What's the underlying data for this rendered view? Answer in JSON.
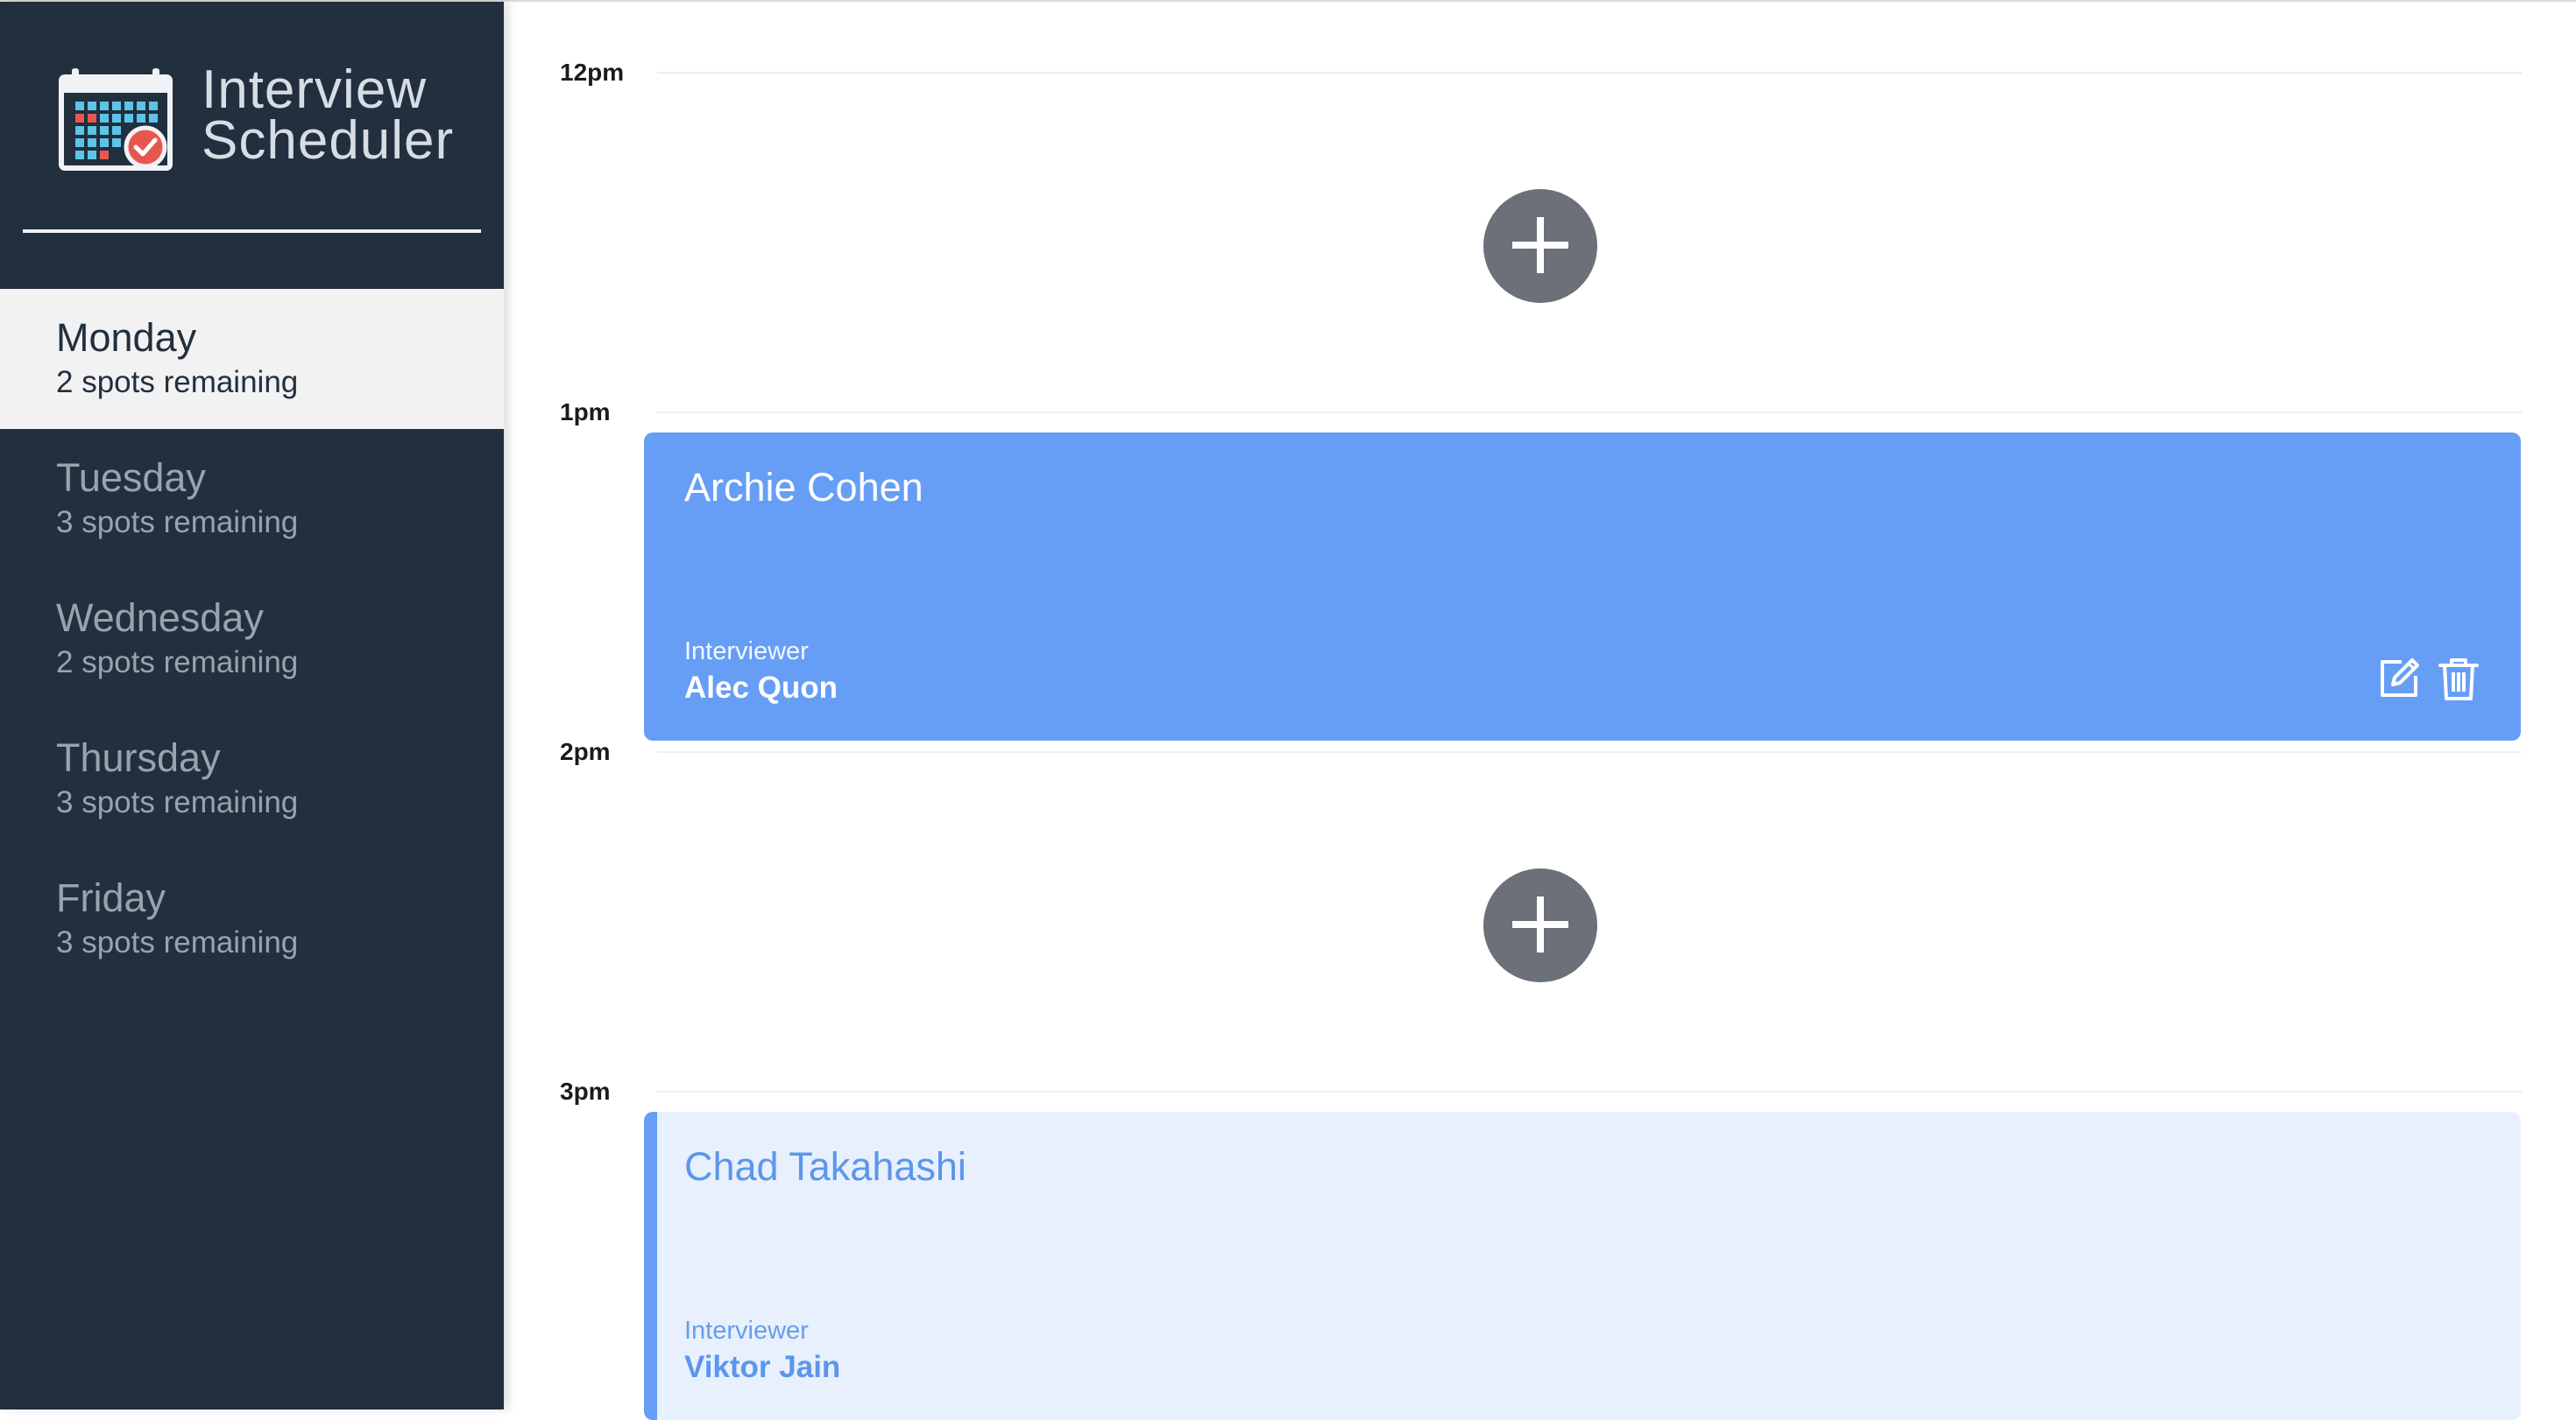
{
  "app": {
    "brand_line1": "Interview",
    "brand_line2": "Scheduler",
    "logo_icon": "calendar-check-icon"
  },
  "days": [
    {
      "name": "Monday",
      "spots": "2 spots remaining",
      "selected": true
    },
    {
      "name": "Tuesday",
      "spots": "3 spots remaining",
      "selected": false
    },
    {
      "name": "Wednesday",
      "spots": "2 spots remaining",
      "selected": false
    },
    {
      "name": "Thursday",
      "spots": "3 spots remaining",
      "selected": false
    },
    {
      "name": "Friday",
      "spots": "3 spots remaining",
      "selected": false
    }
  ],
  "schedule": {
    "times": [
      "12pm",
      "1pm",
      "2pm",
      "3pm"
    ],
    "add_icon": "plus-icon",
    "appointments": [
      {
        "time": "1pm",
        "student": "Archie Cohen",
        "interviewer_label": "Interviewer",
        "interviewer": "Alec Quon",
        "edit_icon": "edit-icon",
        "delete_icon": "trash-icon"
      },
      {
        "time": "3pm",
        "student": "Chad Takahashi",
        "interviewer_label": "Interviewer",
        "interviewer": "Viktor Jain"
      }
    ]
  },
  "colors": {
    "sidebar": "#222f3e",
    "selected_day": "#f2f2f2",
    "booked_card": "#669ef6",
    "upcoming_card": "#e8f0fd",
    "add_button": "#6b7079"
  }
}
